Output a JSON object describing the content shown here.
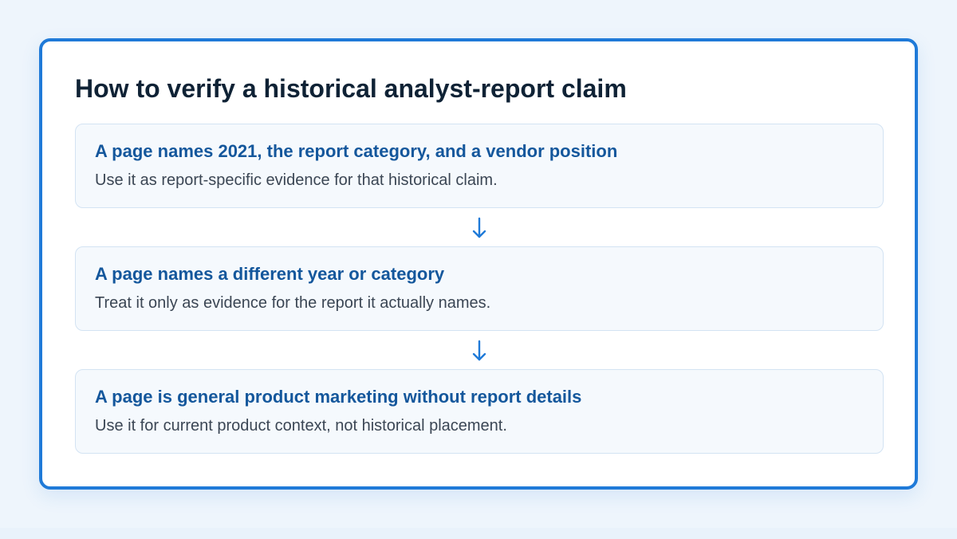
{
  "title": "How to verify a historical analyst-report claim",
  "steps": [
    {
      "heading": "A page names 2021, the report category, and a vendor position",
      "text": "Use it as report-specific evidence for that historical claim."
    },
    {
      "heading": "A page names a different year or category",
      "text": "Treat it only as evidence for the report it actually names."
    },
    {
      "heading": "A page is general product marketing without report details",
      "text": "Use it for current product context, not historical placement."
    }
  ],
  "colors": {
    "accent": "#1f7ad8",
    "heading": "#14579c",
    "title": "#0f2235",
    "body_text": "#3b4654"
  },
  "connector_icon": "arrow-down-icon"
}
